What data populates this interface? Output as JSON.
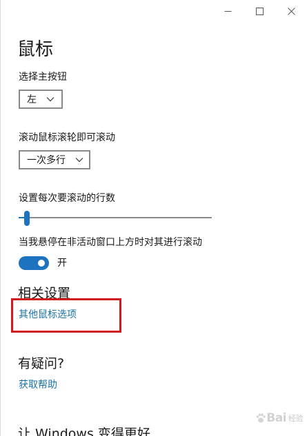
{
  "window": {
    "caption_buttons": [
      "minimize",
      "maximize",
      "close"
    ]
  },
  "page": {
    "title": "鼠标"
  },
  "primary_button": {
    "label": "选择主按钮",
    "value": "左"
  },
  "wheel_scroll": {
    "label": "滚动鼠标滚轮即可滚动",
    "value": "一次多行"
  },
  "lines_per_scroll": {
    "label": "设置每次要滚动的行数",
    "value_fraction": 0.03
  },
  "inactive_scroll": {
    "label": "当我悬停在非活动窗口上方时对其进行滚动",
    "toggle_state": "开",
    "on": true
  },
  "related": {
    "title": "相关设置",
    "link": "其他鼠标选项"
  },
  "help": {
    "title": "有疑问?",
    "link": "获取帮助"
  },
  "feedback": {
    "title": "让 Windows 变得更好"
  },
  "watermark": {
    "text": "Bai",
    "sub": "经验"
  },
  "colors": {
    "accent": "#1e73be",
    "link": "#1a73a8",
    "highlight": "#d4191d"
  }
}
